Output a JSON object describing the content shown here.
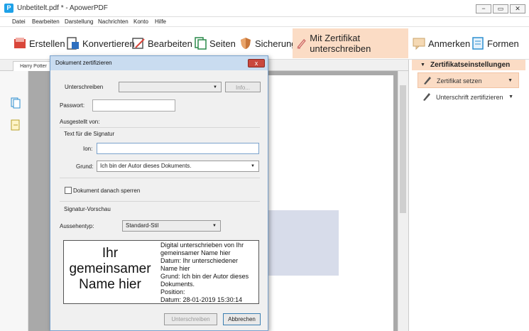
{
  "window": {
    "title": "Unbetitelt.pdf * - ApowerPDF",
    "app_logo": "P",
    "minimize": "−",
    "maximize": "▭",
    "close": "✕"
  },
  "menu": [
    "Datei",
    "Bearbeiten",
    "Darstellung",
    "Nachrichten",
    "Konto",
    "Hilfe"
  ],
  "toolbar": [
    {
      "label": "Erstellen",
      "icon": "create-pdf-icon"
    },
    {
      "label": "Konvertieren",
      "icon": "convert-icon"
    },
    {
      "label": "Bearbeiten",
      "icon": "edit-icon"
    },
    {
      "label": "Seiten",
      "icon": "pages-icon"
    },
    {
      "label": "Sicherung",
      "icon": "shield-icon"
    },
    {
      "label": "Mit Zertifikat unterschreiben",
      "icon": "pen-certificate-icon",
      "active": true
    },
    {
      "label": "Anmerken",
      "icon": "comment-icon"
    },
    {
      "label": "Formen",
      "icon": "forms-icon"
    }
  ],
  "document_tab": "Harry Potter",
  "right_panel": {
    "title": "Zertifikatseinstellungen",
    "items": [
      {
        "label": "Zertifikat setzen",
        "active": true
      },
      {
        "label": "Unterschrift zertifizieren",
        "active": false
      }
    ]
  },
  "dialog": {
    "title": "Dokument zertifizieren",
    "close": "x",
    "sign_label": "Unterschreiben",
    "sign_select": "",
    "info_button": "Info...",
    "password_label": "Passwort:",
    "password_value": "",
    "issued_by": "Ausgestellt von:",
    "signature_text_group": "Text für die Signatur",
    "location_label": "Ion:",
    "location_value": "",
    "reason_label": "Grund:",
    "reason_value": "Ich bin der Autor dieses Dokuments.",
    "lock_checkbox_label": "Dokument danach sperren",
    "lock_checked": false,
    "preview_group": "Signatur-Vorschau",
    "appearance_label": "Aussehentyp:",
    "appearance_value": "Standard-Stil",
    "preview_name": "Ihr gemeinsamer Name hier",
    "preview_lines": [
      "Digital unterschrieben von Ihr",
      "gemeinsamer Name hier",
      "Datum: Ihr unterschiedener",
      "Name hier",
      "Grund: Ich bin der Autor dieses",
      "Dokuments.",
      "Position:",
      "Datum: 28-01-2019 15:30:14"
    ],
    "sign_button": "Unterschreiben",
    "cancel_button": "Abbrechen"
  },
  "colors": {
    "accent_active": "#fbdcc5",
    "dialog_title": "#c9dcf0",
    "close_red": "#c9483e"
  }
}
